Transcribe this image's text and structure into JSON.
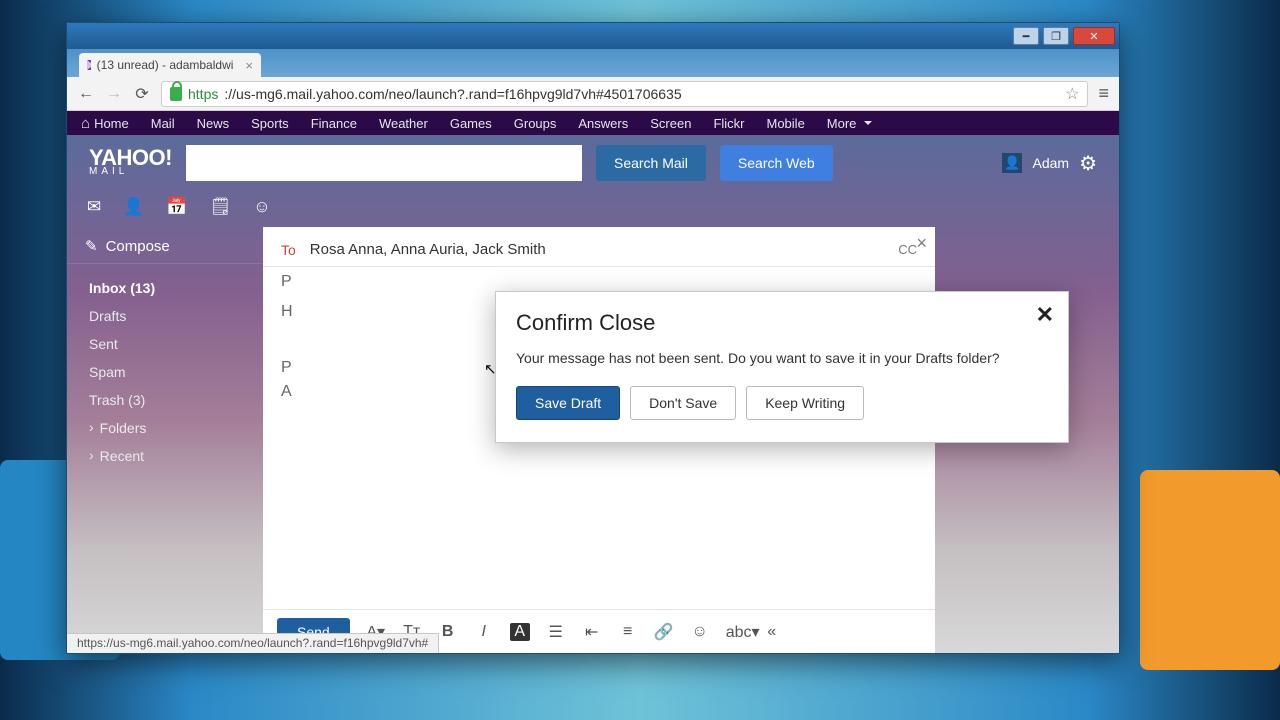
{
  "browser": {
    "tab_title": "(13 unread) - adambaldwi",
    "url_scheme": "https",
    "url_rest": "://us-mg6.mail.yahoo.com/neo/launch?.rand=f16hpvg9ld7vh#4501706635",
    "status_url": "https://us-mg6.mail.yahoo.com/neo/launch?.rand=f16hpvg9ld7vh#"
  },
  "topnav": {
    "home": "Home",
    "items": [
      "Mail",
      "News",
      "Sports",
      "Finance",
      "Weather",
      "Games",
      "Groups",
      "Answers",
      "Screen",
      "Flickr",
      "Mobile"
    ],
    "more": "More"
  },
  "header": {
    "logo_top": "YAHOO!",
    "logo_bottom": "MAIL",
    "search_mail": "Search Mail",
    "search_web": "Search Web",
    "user_name": "Adam"
  },
  "sidebar": {
    "compose": "Compose",
    "items": [
      {
        "label": "Inbox (13)",
        "current": true
      },
      {
        "label": "Drafts"
      },
      {
        "label": "Sent"
      },
      {
        "label": "Spam"
      },
      {
        "label": "Trash (3)"
      },
      {
        "label": "Folders",
        "expando": true
      },
      {
        "label": "Recent",
        "expando": true
      }
    ]
  },
  "compose": {
    "to_label": "To",
    "recipients": "Rosa Anna,  Anna Auria,  Jack Smith",
    "cc": "CC",
    "subject_preview": "P",
    "body_line1": "H",
    "body_line2a": "P",
    "body_line2b": "A",
    "send": "Send"
  },
  "modal": {
    "title": "Confirm Close",
    "message": "Your message has not been sent. Do you want to save it in your Drafts folder?",
    "save": "Save Draft",
    "dont": "Don't Save",
    "keep": "Keep Writing"
  }
}
